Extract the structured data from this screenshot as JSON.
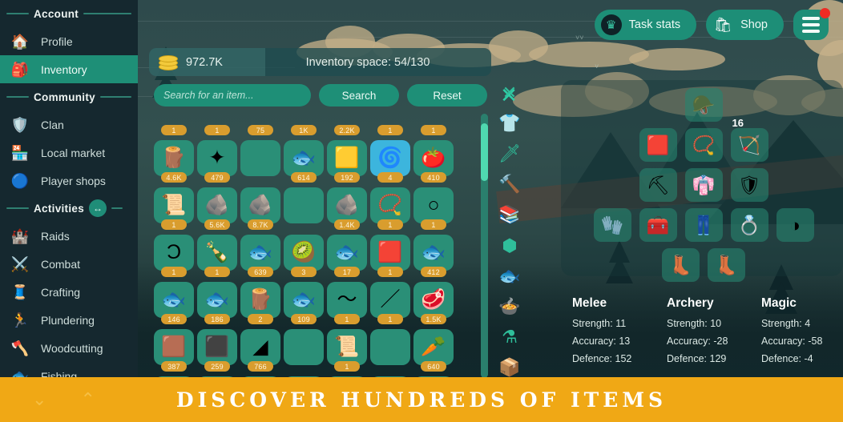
{
  "sidebar": {
    "sections": [
      {
        "title": "Account",
        "toggle": null,
        "items": [
          {
            "label": "Profile",
            "icon": "house-icon",
            "glyph": "🏠",
            "active": false
          },
          {
            "label": "Inventory",
            "icon": "backpack-icon",
            "glyph": "🎒",
            "active": true
          }
        ]
      },
      {
        "title": "Community",
        "toggle": null,
        "items": [
          {
            "label": "Clan",
            "icon": "shield-icon",
            "glyph": "🛡",
            "active": false
          },
          {
            "label": "Local market",
            "icon": "market-stall-icon",
            "glyph": "🏪",
            "active": false
          },
          {
            "label": "Player shops",
            "icon": "player-shop-icon",
            "glyph": "🔵",
            "active": false
          }
        ]
      },
      {
        "title": "Activities",
        "toggle": "expand-collapse-icon",
        "items": [
          {
            "label": "Raids",
            "icon": "castle-icon",
            "glyph": "🏰",
            "active": false
          },
          {
            "label": "Combat",
            "icon": "crossed-swords-shield-icon",
            "glyph": "⚔",
            "active": false
          },
          {
            "label": "Crafting",
            "icon": "crafting-icon",
            "glyph": "🧵",
            "active": false
          },
          {
            "label": "Plundering",
            "icon": "running-thief-icon",
            "glyph": "🏃",
            "active": false
          },
          {
            "label": "Woodcutting",
            "icon": "axe-stump-icon",
            "glyph": "🪓",
            "active": false
          },
          {
            "label": "Fishing",
            "icon": "fish-icon",
            "glyph": "🐟",
            "active": false
          }
        ]
      }
    ]
  },
  "topbar": {
    "task_stats_label": "Task stats",
    "task_stats_icon": "crown-icon",
    "shop_label": "Shop",
    "shop_icon": "shopping-bag-icon",
    "menu_icon": "hamburger-menu-icon",
    "menu_has_notification": true
  },
  "currency": {
    "coin_icon": "gold-coins-icon",
    "amount": "972.7K",
    "inventory_space": "Inventory space: 54/130"
  },
  "search": {
    "placeholder": "Search for an item...",
    "value": "",
    "search_label": "Search",
    "reset_label": "Reset",
    "close_icon": "close-x-icon"
  },
  "filters": [
    {
      "name": "close-x-icon",
      "glyph": "✕"
    },
    {
      "name": "armor-shirt-icon",
      "glyph": "👕"
    },
    {
      "name": "sword-icon",
      "glyph": "🗡"
    },
    {
      "name": "hammer-icon",
      "glyph": "🔨"
    },
    {
      "name": "logs-icon",
      "glyph": "📚"
    },
    {
      "name": "gem-icon",
      "glyph": "⬢"
    },
    {
      "name": "fish-icon",
      "glyph": "🐟"
    },
    {
      "name": "cooked-food-icon",
      "glyph": "🍲"
    },
    {
      "name": "potion-icon",
      "glyph": "⚗"
    },
    {
      "name": "box-icon",
      "glyph": "📦"
    }
  ],
  "inventory": {
    "scrollbar": "vertical-scrollbar",
    "rows": [
      [
        {
          "glyph": "",
          "qty": "1",
          "icon": "item-icon",
          "empty": true
        },
        {
          "glyph": "",
          "qty": "1",
          "icon": "item-icon",
          "empty": true
        },
        {
          "glyph": "",
          "qty": "75",
          "icon": "item-icon",
          "empty": true
        },
        {
          "glyph": "",
          "qty": "1K",
          "icon": "item-icon",
          "empty": true
        },
        {
          "glyph": "",
          "qty": "2.2K",
          "icon": "item-icon",
          "empty": true
        },
        {
          "glyph": "",
          "qty": "1",
          "icon": "item-icon",
          "empty": true
        },
        {
          "glyph": "",
          "qty": "1",
          "icon": "item-icon",
          "empty": true
        }
      ],
      [
        {
          "glyph": "🪵",
          "qty": "4.6K",
          "icon": "log-item-icon"
        },
        {
          "glyph": "✦",
          "qty": "479",
          "icon": "herb-seeds-item-icon"
        },
        {
          "glyph": "",
          "qty": "",
          "icon": "empty-slot"
        },
        {
          "glyph": "🐟",
          "qty": "614",
          "icon": "cooked-fish-item-icon"
        },
        {
          "glyph": "🟨",
          "qty": "192",
          "icon": "gold-bar-item-icon"
        },
        {
          "glyph": "🌀",
          "qty": "4",
          "icon": "air-rune-item-icon",
          "blue": true
        },
        {
          "glyph": "🍅",
          "qty": "410",
          "icon": "tomato-item-icon"
        }
      ],
      [
        {
          "glyph": "📜",
          "qty": "1",
          "icon": "axe-scroll-item-icon"
        },
        {
          "glyph": "🪨",
          "qty": "5.6K",
          "icon": "copper-ore-item-icon"
        },
        {
          "glyph": "🪨",
          "qty": "8.7K",
          "icon": "coal-ore-item-icon"
        },
        {
          "glyph": "",
          "qty": "",
          "icon": "empty-slot"
        },
        {
          "glyph": "🪨",
          "qty": "1.4K",
          "icon": "silver-ore-item-icon"
        },
        {
          "glyph": "📿",
          "qty": "1",
          "icon": "amulet-item-icon"
        },
        {
          "glyph": "○",
          "qty": "1",
          "icon": "ring-item-icon"
        }
      ],
      [
        {
          "glyph": "Ɔ",
          "qty": "1",
          "icon": "gold-ring-item-icon"
        },
        {
          "glyph": "🍾",
          "qty": "1",
          "icon": "potion-bottles-item-icon"
        },
        {
          "glyph": "🐟",
          "qty": "639",
          "icon": "raw-fish-item-icon"
        },
        {
          "glyph": "🥝",
          "qty": "3",
          "icon": "kiwi-item-icon"
        },
        {
          "glyph": "🐟",
          "qty": "17",
          "icon": "skewered-fish-item-icon"
        },
        {
          "glyph": "🟥",
          "qty": "1",
          "icon": "red-cape-item-icon"
        },
        {
          "glyph": "🐟",
          "qty": "412",
          "icon": "blue-fish-item-icon"
        }
      ],
      [
        {
          "glyph": "🐟",
          "qty": "146",
          "icon": "grilled-fish-item-icon"
        },
        {
          "glyph": "🐟",
          "qty": "186",
          "icon": "skewer-item-icon"
        },
        {
          "glyph": "🪵",
          "qty": "2",
          "icon": "log-roll-item-icon"
        },
        {
          "glyph": "🐟",
          "qty": "109",
          "icon": "roast-fish-item-icon"
        },
        {
          "glyph": "〜",
          "qty": "1",
          "icon": "rope-item-icon"
        },
        {
          "glyph": "／",
          "qty": "1",
          "icon": "spear-item-icon"
        },
        {
          "glyph": "🥩",
          "qty": "1.5K",
          "icon": "raw-meat-item-icon"
        }
      ],
      [
        {
          "glyph": "🟫",
          "qty": "387",
          "icon": "bronze-bar-item-icon"
        },
        {
          "glyph": "⬛",
          "qty": "259",
          "icon": "iron-bar-item-icon"
        },
        {
          "glyph": "◢",
          "qty": "766",
          "icon": "steel-item-icon"
        },
        {
          "glyph": "",
          "qty": "",
          "icon": "empty-slot"
        },
        {
          "glyph": "📜",
          "qty": "1",
          "icon": "pickaxe-scroll-item-icon"
        },
        {
          "glyph": "",
          "qty": "",
          "icon": "empty-slot"
        },
        {
          "glyph": "🥕",
          "qty": "640",
          "icon": "carrot-item-icon"
        }
      ],
      [
        {
          "glyph": "",
          "qty": "",
          "icon": "empty-slot"
        },
        {
          "glyph": "",
          "qty": "",
          "icon": "empty-slot"
        },
        {
          "glyph": "",
          "qty": "",
          "icon": "empty-slot"
        },
        {
          "glyph": "",
          "qty": "",
          "icon": "empty-slot"
        },
        {
          "glyph": "",
          "qty": "",
          "icon": "empty-slot"
        },
        {
          "glyph": "",
          "qty": "",
          "icon": "empty-slot"
        },
        {
          "glyph": "",
          "qty": "",
          "icon": "empty-slot"
        }
      ]
    ]
  },
  "equipment": {
    "rows": [
      [
        {
          "name": "helmet-slot",
          "glyph": "🪖",
          "filled": true,
          "badge": "",
          "offset": 1
        }
      ],
      [
        {
          "name": "cape-slot",
          "glyph": "🟥",
          "filled": true,
          "badge": ""
        },
        {
          "name": "necklace-slot",
          "glyph": "📿",
          "filled": true,
          "badge": ""
        },
        {
          "name": "ammo-slot",
          "glyph": "🏹",
          "filled": true,
          "badge": "16"
        }
      ],
      [
        {
          "name": "weapon-slot",
          "glyph": "⛏",
          "filled": true,
          "badge": ""
        },
        {
          "name": "body-slot",
          "glyph": "👘",
          "filled": true,
          "badge": ""
        },
        {
          "name": "shield-slot",
          "glyph": "🛡",
          "filled": true,
          "badge": ""
        }
      ],
      [
        {
          "name": "gloves-slot",
          "glyph": "🧤",
          "filled": true,
          "badge": ""
        },
        {
          "name": "tool-belt-slot",
          "glyph": "🧰",
          "filled": true,
          "badge": ""
        },
        {
          "name": "legs-slot",
          "glyph": "👖",
          "filled": true,
          "badge": ""
        },
        {
          "name": "ring-slot",
          "glyph": "💍",
          "filled": true,
          "badge": ""
        },
        {
          "name": "bracelet-slot",
          "glyph": "◑",
          "filled": true,
          "badge": ""
        }
      ],
      [
        {
          "name": "boots-slot",
          "glyph": "👢",
          "filled": true,
          "badge": ""
        },
        {
          "name": "secondary-boots-slot",
          "glyph": "👢",
          "filled": true,
          "badge": ""
        }
      ]
    ]
  },
  "stats": [
    {
      "title": "Melee",
      "strength": "Strength: 11",
      "accuracy": "Accuracy: 13",
      "defence": "Defence: 152"
    },
    {
      "title": "Archery",
      "strength": "Strength: 10",
      "accuracy": "Accuracy: -28",
      "defence": "Defence: 129"
    },
    {
      "title": "Magic",
      "strength": "Strength: 4",
      "accuracy": "Accuracy: -58",
      "defence": "Defence: -4"
    }
  ],
  "banner": {
    "text": "DISCOVER HUNDREDS OF ITEMS",
    "chevron_down_icon": "chevron-down-icon",
    "chevron_up_icon": "chevron-up-icon",
    "color": "#f0a815"
  },
  "colors": {
    "accent_teal": "#1e8f77",
    "tile_teal": "#2a8f77",
    "qty_badge": "#d99d2e",
    "sidebar_bg": "#15282f",
    "banner_yellow": "#f0a815",
    "notification_red": "#ee2b24"
  }
}
